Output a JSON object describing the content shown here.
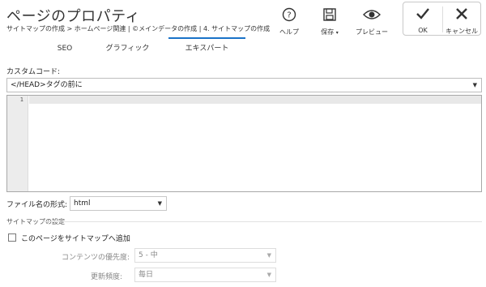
{
  "header": {
    "title": "ページのプロパティ",
    "breadcrumb": "サイトマップの作成 > ホームページ関連 | ©メインデータの作成 | 4. サイトマップの作成"
  },
  "toolbar": {
    "help": "ヘルプ",
    "save": "保存",
    "preview": "プレビュー",
    "ok": "OK",
    "cancel": "キャンセル"
  },
  "tabs": [
    "SEO",
    "グラフィック",
    "エキスパート"
  ],
  "active_tab": "エキスパート",
  "custom_code": {
    "label": "カスタムコード:",
    "position": "</HEAD>タグの前に",
    "line_number": "1"
  },
  "file_format": {
    "label": "ファイル名の形式:",
    "value": "html"
  },
  "sitemap": {
    "section_label": "サイトマップの設定",
    "add_label": "このページをサイトマップへ追加",
    "add_checked": false,
    "priority_label": "コンテンツの優先度:",
    "priority_value": "5 - 中",
    "frequency_label": "更新頻度:",
    "frequency_value": "毎日"
  },
  "colors": {
    "accent": "#1a73c8"
  }
}
